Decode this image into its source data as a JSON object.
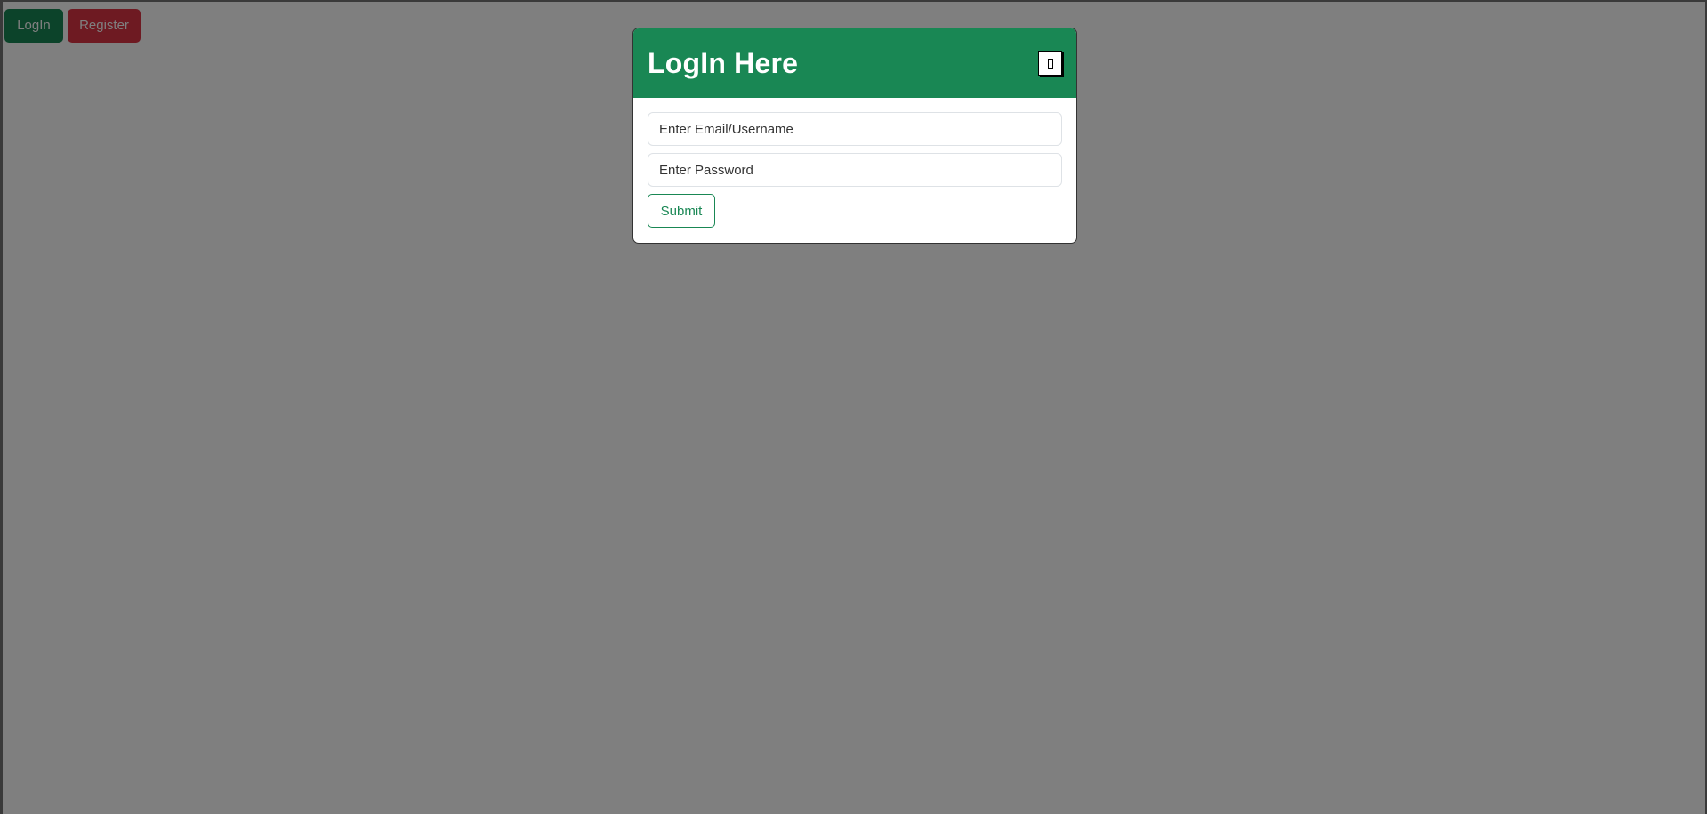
{
  "topbar": {
    "login_label": "LogIn",
    "register_label": "Register"
  },
  "modal": {
    "title": "LogIn Here",
    "close_icon": "close-icon",
    "email_placeholder": "Enter Email/Username",
    "email_value": "",
    "password_placeholder": "Enter Password",
    "password_value": "",
    "submit_label": "Submit"
  },
  "colors": {
    "success": "#198754",
    "danger": "#dc3545",
    "overlay": "rgba(0,0,0,0.5)"
  }
}
